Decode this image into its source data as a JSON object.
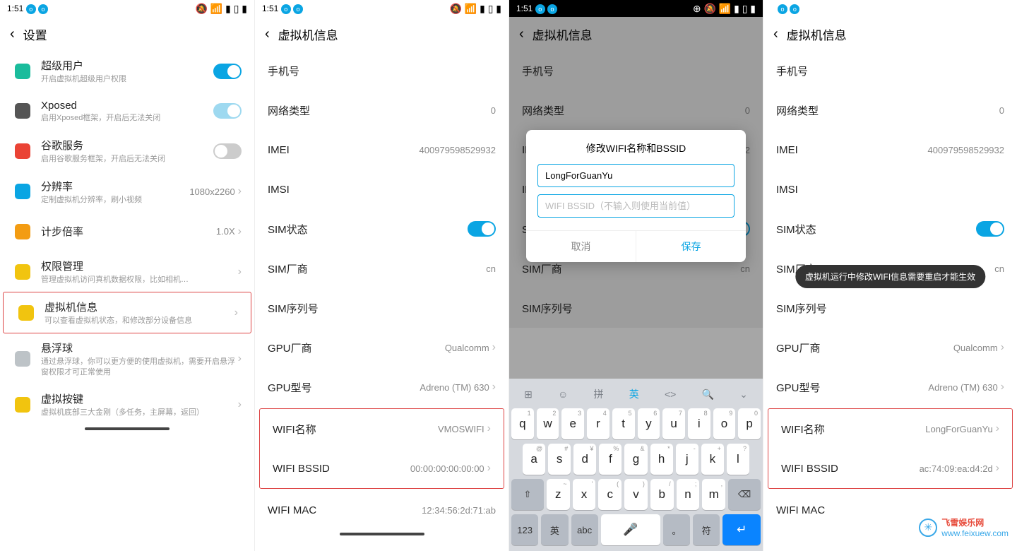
{
  "status": {
    "time": "1:51"
  },
  "p1": {
    "header": "设置",
    "items": [
      {
        "icon": "lock-icon",
        "color": "#1abc9c",
        "title": "超级用户",
        "sub": "开启虚拟机超级用户权限",
        "ctrl": "toggle-on"
      },
      {
        "icon": "xposed-icon",
        "color": "#555",
        "title": "Xposed",
        "sub": "启用Xposed框架，开启后无法关闭",
        "ctrl": "toggle-on-light"
      },
      {
        "icon": "google-icon",
        "color": "#ea4335",
        "title": "谷歌服务",
        "sub": "启用谷歌服务框架，开启后无法关闭",
        "ctrl": "toggle-off"
      },
      {
        "icon": "resolution-icon",
        "color": "#0aa5e3",
        "title": "分辨率",
        "sub": "定制虚拟机分辨率，刷小视频",
        "value": "1080x2260",
        "ctrl": "chevron"
      },
      {
        "icon": "run-icon",
        "color": "#f39c12",
        "title": "计步倍率",
        "value": "1.0X",
        "ctrl": "chevron"
      },
      {
        "icon": "perm-icon",
        "color": "#f1c40f",
        "title": "权限管理",
        "sub": "管理虚拟机访问真机数据权限，比如相机…",
        "ctrl": "chevron"
      },
      {
        "icon": "vm-info-icon",
        "color": "#f1c40f",
        "title": "虚拟机信息",
        "sub": "可以查看虚拟机状态，和修改部分设备信息",
        "ctrl": "chevron",
        "hl": true
      },
      {
        "icon": "float-icon",
        "color": "#bdc3c7",
        "title": "悬浮球",
        "sub": "通过悬浮球，你可以更方便的使用虚拟机，需要开启悬浮窗权限才可正常使用",
        "ctrl": "chevron"
      },
      {
        "icon": "keys-icon",
        "color": "#f1c40f",
        "title": "虚拟按键",
        "sub": "虚拟机底部三大金刚（多任务，主屏幕，返回）",
        "ctrl": "chevron"
      }
    ]
  },
  "p2": {
    "header": "虚拟机信息",
    "rows": [
      {
        "label": "手机号",
        "value": ""
      },
      {
        "label": "网络类型",
        "value": "0"
      },
      {
        "label": "IMEI",
        "value": "400979598529932"
      },
      {
        "label": "IMSI",
        "value": ""
      },
      {
        "label": "SIM状态",
        "ctrl": "toggle-on"
      },
      {
        "label": "SIM厂商",
        "value": "cn"
      },
      {
        "label": "SIM序列号",
        "value": ""
      },
      {
        "label": "GPU厂商",
        "value": "Qualcomm",
        "chev": true
      },
      {
        "label": "GPU型号",
        "value": "Adreno (TM) 630",
        "chev": true
      },
      {
        "label": "WIFI名称",
        "value": "VMOSWIFI",
        "chev": true,
        "hlstart": true
      },
      {
        "label": "WIFI BSSID",
        "value": "00:00:00:00:00:00",
        "chev": true,
        "hlend": true
      },
      {
        "label": "WIFI MAC",
        "value": "12:34:56:2d:71:ab"
      }
    ]
  },
  "p3": {
    "dialog": {
      "title": "修改WIFI名称和BSSID",
      "input_value": "LongForGuanYu",
      "placeholder": "WIFI BSSID（不输入则使用当前值）",
      "cancel": "取消",
      "save": "保存"
    },
    "kb": {
      "toolbar": [
        "⊞",
        "☺",
        "拼",
        "英",
        "<>",
        "🔍",
        "⌄"
      ],
      "r1": [
        "q:1",
        "w:2",
        "e:3",
        "r:4",
        "t:5",
        "y:6",
        "u:7",
        "i:8",
        "o:9",
        "p:0"
      ],
      "r2": [
        "a:@",
        "s:#",
        "d:¥",
        "f:%",
        "g:&",
        "h:*",
        "j:-",
        "k:+",
        "l:?"
      ],
      "r3_shift": "⇧",
      "r3": [
        "z:~",
        "x:'",
        "c:(",
        "v:)",
        "b:/",
        "n:;",
        "m:,"
      ],
      "r3_del": "⌫",
      "r4": {
        "num": "123",
        "lang": "英",
        "abc": "abc",
        "space": "mic",
        "dot": "。",
        "sym": "符",
        "enter": "↵"
      }
    }
  },
  "p4": {
    "header": "虚拟机信息",
    "toast": "虚拟机运行中修改WIFI信息需要重启才能生效",
    "rows": [
      {
        "label": "手机号",
        "value": ""
      },
      {
        "label": "网络类型",
        "value": "0"
      },
      {
        "label": "IMEI",
        "value": "400979598529932"
      },
      {
        "label": "IMSI",
        "value": ""
      },
      {
        "label": "SIM状态",
        "ctrl": "toggle-on"
      },
      {
        "label": "SIM厂商",
        "value": "cn"
      },
      {
        "label": "SIM序列号",
        "value": ""
      },
      {
        "label": "GPU厂商",
        "value": "Qualcomm",
        "chev": true
      },
      {
        "label": "GPU型号",
        "value": "Adreno (TM) 630",
        "chev": true
      },
      {
        "label": "WIFI名称",
        "value": "LongForGuanYu",
        "chev": true,
        "hlstart": true
      },
      {
        "label": "WIFI BSSID",
        "value": "ac:74:09:ea:d4:2d",
        "chev": true,
        "hlend": true
      },
      {
        "label": "WIFI MAC",
        "value": ""
      }
    ],
    "watermark": {
      "name": "飞雪娱乐网",
      "url": "www.feixuew.com"
    }
  }
}
